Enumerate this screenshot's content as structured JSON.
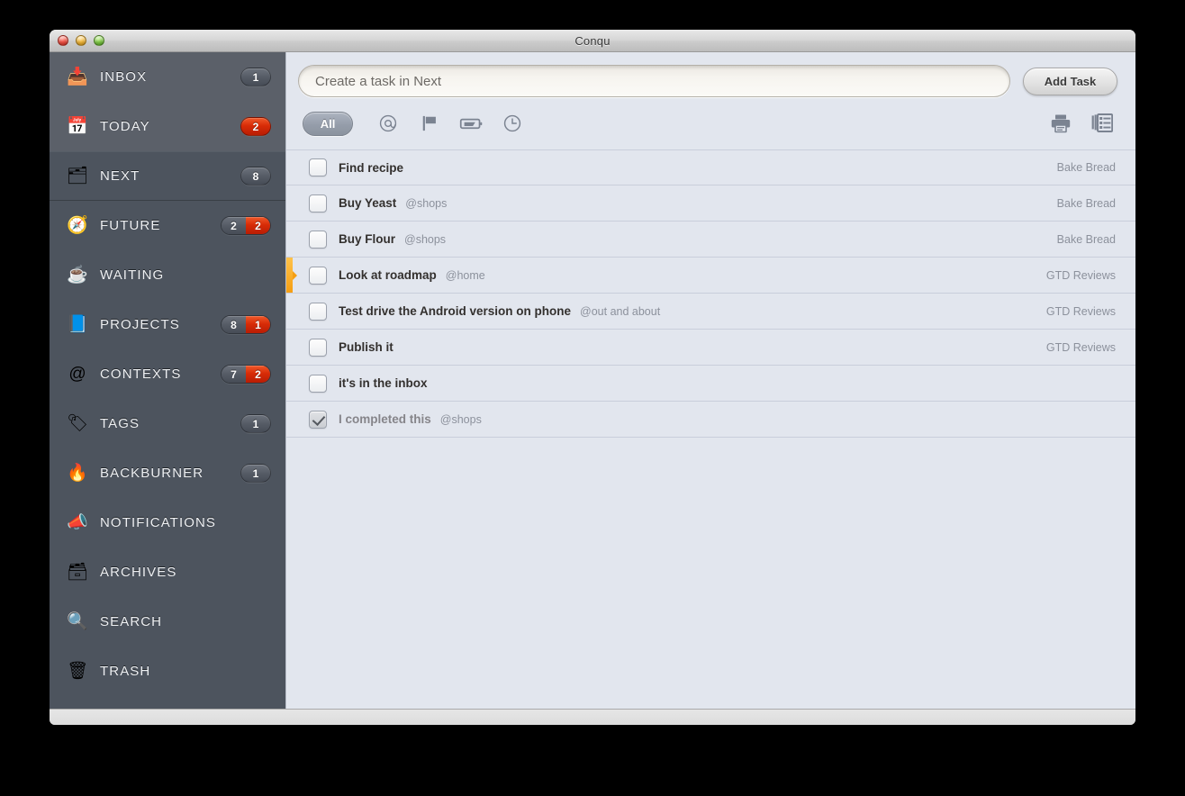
{
  "window": {
    "title": "Conqu",
    "traffic_lights": [
      "close",
      "minimize",
      "zoom"
    ]
  },
  "sidebar": {
    "top_items": [
      {
        "icon": "inbox-tray-icon",
        "glyph": "📥",
        "label": "INBOX",
        "badge": {
          "type": "single",
          "value": "1",
          "style": "grey"
        }
      },
      {
        "icon": "calendar-icon",
        "glyph": "📅",
        "label": "TODAY",
        "badge": {
          "type": "single",
          "value": "2",
          "style": "red"
        }
      }
    ],
    "main_items": [
      {
        "icon": "folder-bookmark-icon",
        "glyph": "🗂",
        "label": "NEXT",
        "selected": true,
        "badge": {
          "type": "single",
          "value": "8",
          "style": "grey"
        }
      },
      {
        "icon": "clock-compass-icon",
        "glyph": "🧭",
        "label": "FUTURE",
        "selected": false,
        "badge": {
          "type": "split",
          "left": "2",
          "right": "2"
        }
      },
      {
        "icon": "coffee-cup-icon",
        "glyph": "☕",
        "label": "WAITING",
        "selected": false,
        "badge": null
      },
      {
        "icon": "book-bookmark-icon",
        "glyph": "📘",
        "label": "PROJECTS",
        "selected": false,
        "badge": {
          "type": "split",
          "left": "8",
          "right": "1"
        }
      },
      {
        "icon": "at-sign-icon",
        "glyph": "@",
        "label": "CONTEXTS",
        "selected": false,
        "badge": {
          "type": "split",
          "left": "7",
          "right": "2"
        }
      },
      {
        "icon": "tags-icon",
        "glyph": "🏷",
        "label": "TAGS",
        "selected": false,
        "badge": {
          "type": "single",
          "value": "1",
          "style": "grey"
        }
      },
      {
        "icon": "flame-icon",
        "glyph": "🔥",
        "label": "BACKBURNER",
        "selected": false,
        "badge": {
          "type": "single",
          "value": "1",
          "style": "grey"
        }
      },
      {
        "icon": "megaphone-icon",
        "glyph": "📣",
        "label": "NOTIFICATIONS",
        "selected": false,
        "badge": null
      },
      {
        "icon": "archive-box-icon",
        "glyph": "🗃",
        "label": "ARCHIVES",
        "selected": false,
        "badge": null
      },
      {
        "icon": "magnifier-icon",
        "glyph": "🔍",
        "label": "SEARCH",
        "selected": false,
        "badge": null
      },
      {
        "icon": "trash-can-icon",
        "glyph": "🗑",
        "label": "TRASH",
        "selected": false,
        "badge": null
      }
    ]
  },
  "toolbar": {
    "task_input_placeholder": "Create a task in Next",
    "task_input_value": "",
    "add_task_label": "Add Task",
    "filters": [
      {
        "name": "all",
        "label": "All",
        "active": true
      },
      {
        "name": "context",
        "icon": "at-sign-icon",
        "active": false
      },
      {
        "name": "flag",
        "icon": "flag-icon",
        "active": false
      },
      {
        "name": "tag",
        "icon": "tag-icon",
        "active": false
      },
      {
        "name": "time",
        "icon": "clock-icon",
        "active": false
      }
    ],
    "right_buttons": [
      {
        "name": "print",
        "icon": "printer-icon"
      },
      {
        "name": "view",
        "icon": "list-view-icon"
      }
    ]
  },
  "tasks": [
    {
      "title": "Find recipe",
      "context": "",
      "project": "Bake Bread",
      "done": false,
      "marked": false
    },
    {
      "title": "Buy Yeast",
      "context": "@shops",
      "project": "Bake Bread",
      "done": false,
      "marked": false
    },
    {
      "title": "Buy Flour",
      "context": "@shops",
      "project": "Bake Bread",
      "done": false,
      "marked": false
    },
    {
      "title": "Look at roadmap",
      "context": "@home",
      "project": "GTD Reviews",
      "done": false,
      "marked": true
    },
    {
      "title": "Test drive the Android version on phone",
      "context": "@out and about",
      "project": "GTD Reviews",
      "done": false,
      "marked": false
    },
    {
      "title": "Publish it",
      "context": "",
      "project": "GTD Reviews",
      "done": false,
      "marked": false
    },
    {
      "title": "it's in the inbox",
      "context": "",
      "project": "",
      "done": false,
      "marked": false
    },
    {
      "title": "I completed this",
      "context": "@shops",
      "project": "",
      "done": true,
      "marked": false
    }
  ],
  "colors": {
    "sidebar_bg": "#4d545e",
    "sidebar_top_bg": "#5b6069",
    "sidebar_selected": "#3c424b",
    "content_bg": "#e2e6ee",
    "badge_red": "#d82c07",
    "marker_orange": "#f59e12",
    "row_divider": "#c9cedb"
  }
}
